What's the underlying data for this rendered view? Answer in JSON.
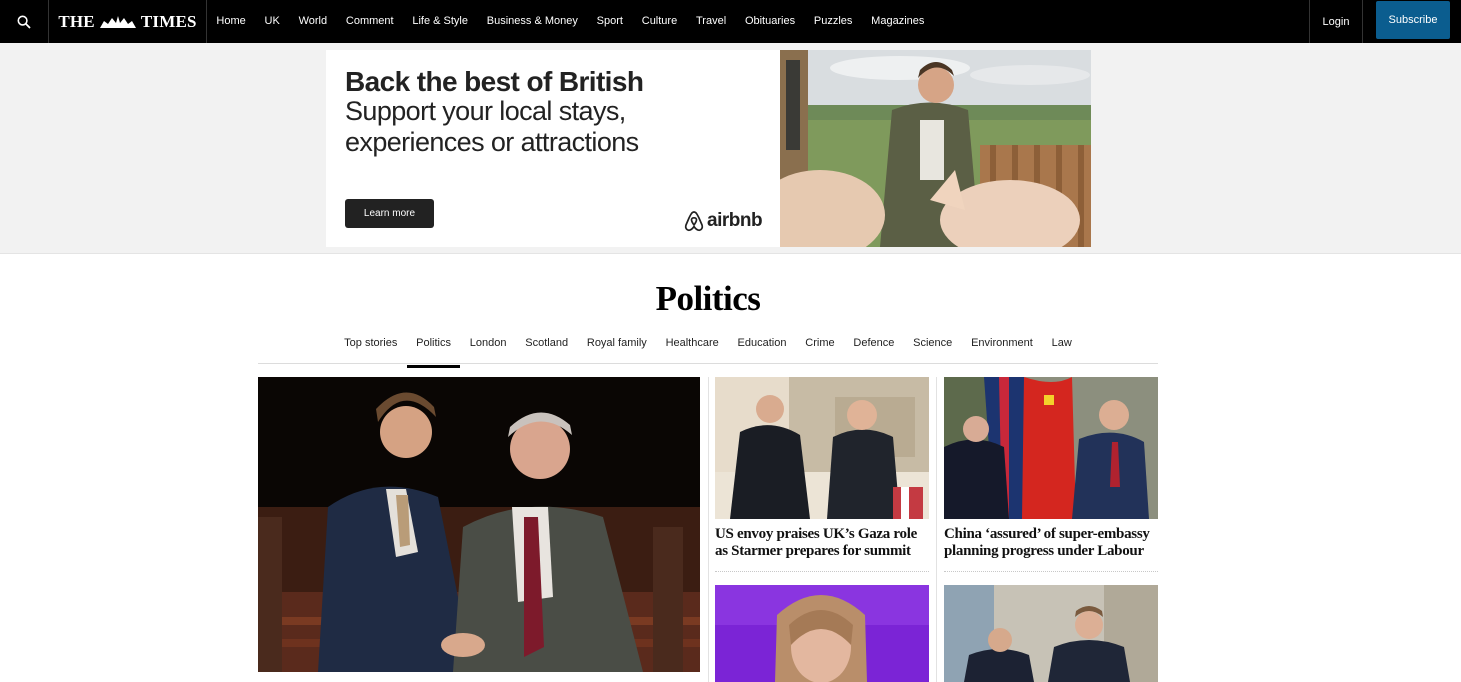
{
  "header": {
    "logo": {
      "left": "THE",
      "right": "TIMES"
    },
    "nav": [
      "Home",
      "UK",
      "World",
      "Comment",
      "Life & Style",
      "Business & Money",
      "Sport",
      "Culture",
      "Travel",
      "Obituaries",
      "Puzzles",
      "Magazines"
    ],
    "login": "Login",
    "subscribe": "Subscribe"
  },
  "ad": {
    "headline": "Back the best of British",
    "subline": "Support your local stays, experiences or attractions",
    "cta": "Learn more",
    "brand": "airbnb"
  },
  "section": {
    "title": "Politics",
    "tabs": [
      "Top stories",
      "Politics",
      "London",
      "Scotland",
      "Royal family",
      "Healthcare",
      "Education",
      "Crime",
      "Defence",
      "Science",
      "Environment",
      "Law"
    ],
    "active_tab": "Politics"
  },
  "articles": {
    "a1": {
      "headline": "US envoy praises UK’s Gaza role as Starmer prepares for summit"
    },
    "a2": {
      "headline": "China ‘assured’ of super-embassy planning progress under Labour"
    }
  },
  "colors": {
    "topbar": "#000000",
    "subscribe": "#0b5d8f",
    "ad_band": "#f2f2f2"
  }
}
